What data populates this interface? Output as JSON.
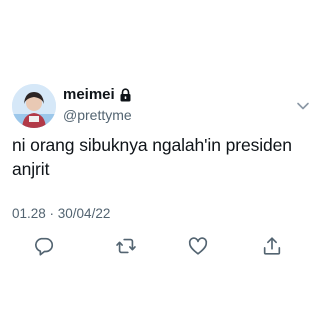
{
  "author": {
    "display_name": "meimei",
    "handle": "@prettyme",
    "protected_icon": "lock-icon",
    "avatar_icon": "avatar"
  },
  "tweet": {
    "text_line1": "ni orang sibuknya ngalah'in presiden",
    "text_line2": "anjrit",
    "timestamp": "01.28 · 30/04/22"
  },
  "actions": [
    {
      "name": "reply-icon"
    },
    {
      "name": "retweet-icon"
    },
    {
      "name": "like-icon"
    },
    {
      "name": "share-icon"
    }
  ],
  "colors": {
    "text": "#0f1419",
    "secondary": "#536471",
    "icon": "#536471",
    "background": "#ffffff"
  }
}
